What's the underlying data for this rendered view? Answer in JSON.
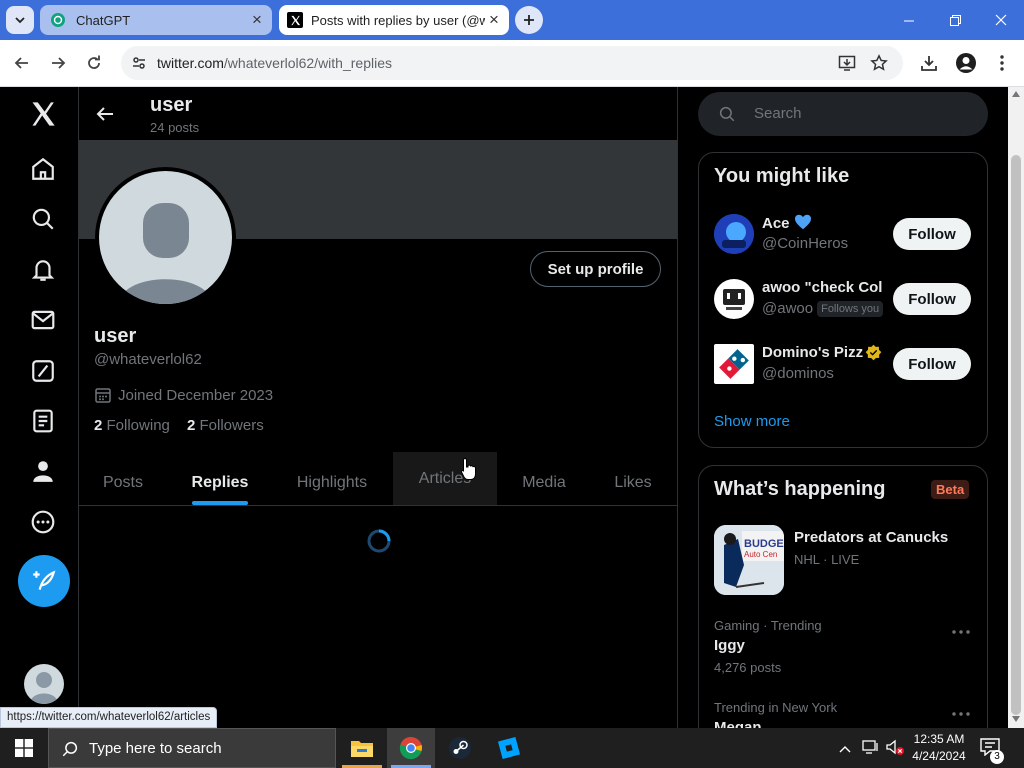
{
  "browser": {
    "tabs": [
      {
        "title": "ChatGPT",
        "active": false
      },
      {
        "title": "Posts with replies by user (@wh",
        "active": true
      }
    ],
    "url": {
      "host": "twitter.com",
      "path": "/whateverlol62/with_replies"
    },
    "status_link": "https://twitter.com/whateverlol62/articles"
  },
  "header": {
    "name": "user",
    "post_count": "24 posts"
  },
  "profile": {
    "display_name": "user",
    "handle": "@whateverlol62",
    "joined": "Joined December 2023",
    "following_count": "2",
    "following_label": "Following",
    "followers_count": "2",
    "followers_label": "Followers",
    "setup_button": "Set up profile"
  },
  "profile_tabs": [
    "Posts",
    "Replies",
    "Highlights",
    "Articles",
    "Media",
    "Likes"
  ],
  "active_tab": "Replies",
  "search": {
    "placeholder": "Search"
  },
  "you_might_like": {
    "title": "You might like",
    "users": [
      {
        "name": "Ace",
        "handle": "@CoinHeros",
        "badge": "blue-heart",
        "follows_you": false,
        "follow_label": "Follow"
      },
      {
        "name": "awoo \"check Col",
        "handle": "@awoo",
        "follows_you_label": "Follows you",
        "follows_you": true,
        "follow_label": "Follow"
      },
      {
        "name": "Domino's Pizz",
        "handle": "@dominos",
        "badge": "gold-verified",
        "follows_you": false,
        "follow_label": "Follow"
      }
    ],
    "show_more": "Show more"
  },
  "whats_happening": {
    "title": "What’s happening",
    "badge": "Beta",
    "items": [
      {
        "title": "Predators at Canucks",
        "meta": "NHL · LIVE"
      },
      {
        "context": "Gaming · Trending",
        "title": "Iggy",
        "count": "4,276 posts"
      },
      {
        "context": "Trending in New York",
        "title": "Megan"
      }
    ]
  },
  "taskbar": {
    "search_placeholder": "Type here to search",
    "time": "12:35 AM",
    "date": "4/24/2024",
    "notification_count": "3"
  },
  "colors": {
    "accent": "#1d9bf0",
    "chrome_blue": "#3c6fd9",
    "background": "#000000",
    "muted": "#71767b"
  }
}
